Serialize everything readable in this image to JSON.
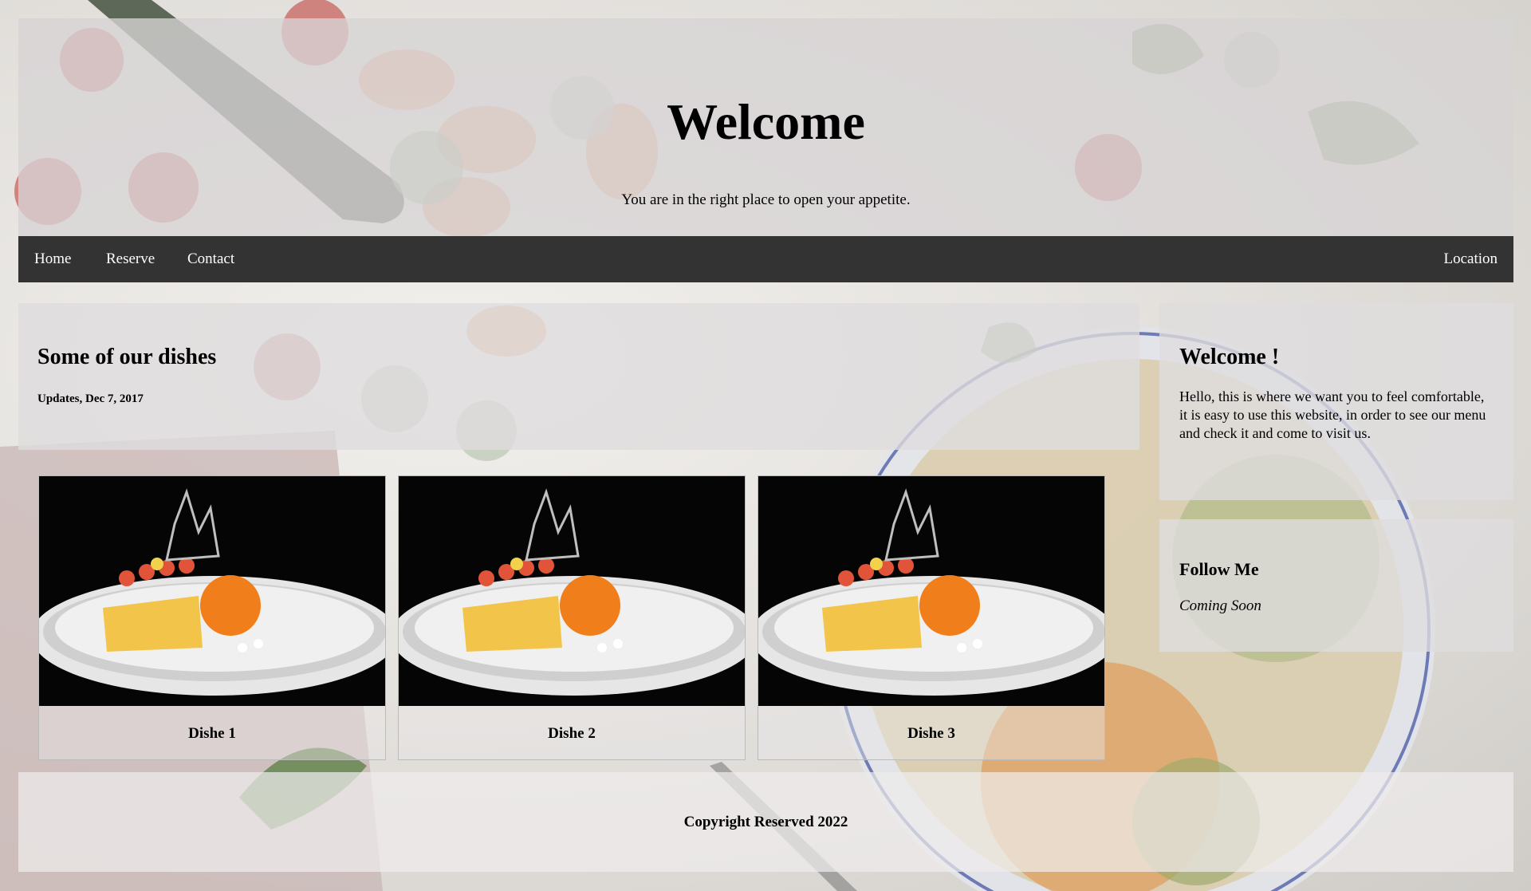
{
  "header": {
    "title": "Welcome",
    "tagline": "You are in the right place to open your appetite."
  },
  "nav": {
    "items": [
      {
        "label": "Home"
      },
      {
        "label": "Reserve"
      },
      {
        "label": "Contact"
      }
    ],
    "right_item": {
      "label": "Location"
    }
  },
  "dishes": {
    "heading": "Some of our dishes",
    "update": "Updates, Dec 7, 2017",
    "items": [
      {
        "caption": "Dishe 1"
      },
      {
        "caption": "Dishe 2"
      },
      {
        "caption": "Dishe 3"
      }
    ]
  },
  "sidebar": {
    "welcome": {
      "heading": "Welcome !",
      "text": "Hello, this is where we want you to feel comfortable, it is easy to use this website, in order to see our menu and check it and come to visit us."
    },
    "follow": {
      "heading": "Follow Me",
      "text": "Coming Soon"
    }
  },
  "footer": {
    "text": "Copyright Reserved 2022"
  },
  "colors": {
    "nav_bg": "#333333",
    "nav_text": "#ffffff",
    "card_bg": "#dedcdd",
    "dish_photo_bg": "#050505"
  }
}
